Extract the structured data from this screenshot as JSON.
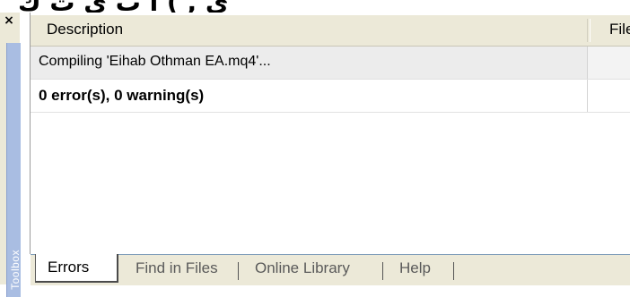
{
  "top_strip": {
    "text": "ي , ) ا ب ي ت ك"
  },
  "sidebar": {
    "close_glyph": "×",
    "toolbox_label": "Toolbox"
  },
  "grid": {
    "columns": [
      "Description",
      "File"
    ],
    "rows": [
      {
        "description": "Compiling 'Eihab Othman EA.mq4'...",
        "file": ""
      },
      {
        "description": "0 error(s), 0 warning(s)",
        "file": ""
      }
    ]
  },
  "tabs": [
    {
      "label": "Errors",
      "active": true
    },
    {
      "label": "Find in Files",
      "active": false
    },
    {
      "label": "Online Library",
      "active": false
    },
    {
      "label": "Help",
      "active": false
    }
  ],
  "colors": {
    "toolbox_tab": "#a9bde2",
    "chrome": "#ece9d8",
    "selected_row": "#ececec"
  }
}
